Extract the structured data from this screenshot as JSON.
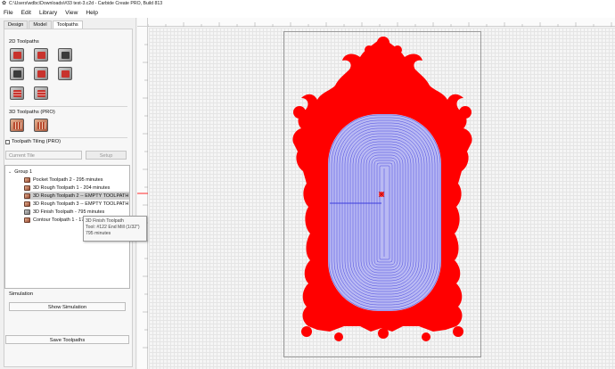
{
  "window": {
    "icon": "carbide-create-icon",
    "title": "C:\\Users\\wdbc\\Downloads\\#33 test-3.c2d - Carbide Create PRO, Build 813"
  },
  "menu": [
    "File",
    "Edit",
    "Library",
    "View",
    "Help"
  ],
  "panel": {
    "tabs": [
      "Design",
      "Model",
      "Toolpaths"
    ],
    "active_tab": "Toolpaths",
    "section_2d": "2D Toolpaths",
    "section_3d": "3D Toolpaths (PRO)",
    "tiling_label": "Toolpath Tiling (PRO)",
    "tile_select": "Current Tile",
    "setup_label": "Setup",
    "tree": {
      "group": "Group 1",
      "items": [
        {
          "label": "Pocket Toolpath 2 - 295 minutes",
          "icon": "pocket-toolpath-icon",
          "selected": false
        },
        {
          "label": "3D Rough Toolpath 1 - 204 minutes",
          "icon": "3d-rough-icon",
          "selected": false
        },
        {
          "label": "3D Rough Toolpath 2 -- EMPTY TOOLPATH",
          "icon": "3d-rough-icon",
          "selected": true
        },
        {
          "label": "3D Rough Toolpath 3 -- EMPTY TOOLPATH",
          "icon": "3d-rough-icon",
          "selected": false
        },
        {
          "label": "3D Finish Toolpath - 795 minutes",
          "icon": "3d-finish-icon",
          "selected": false
        },
        {
          "label": "Contour Toolpath 1 - 17",
          "icon": "contour-toolpath-icon",
          "selected": false
        }
      ]
    },
    "tooltip": {
      "line1": "3D Finish Toolpath",
      "line2": "Tool: #122 End Mill (1/32\")",
      "line3": "795 minutes"
    },
    "simulation_label": "Simulation",
    "show_simulation": "Show Simulation",
    "save_toolpaths": "Save Toolpaths"
  },
  "colors": {
    "design_fill": "#ff0000",
    "toolpath": "#3b3bdc",
    "panel_bg": "#f0f0f0"
  }
}
